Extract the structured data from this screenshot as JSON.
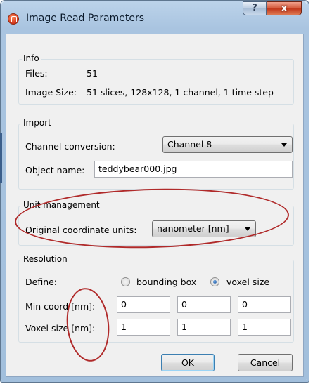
{
  "window": {
    "title": "Image Read Parameters",
    "help_label": "?",
    "close_label": "x"
  },
  "info": {
    "title": "Info",
    "files_label": "Files:",
    "files_value": "51",
    "image_size_label": "Image Size:",
    "image_size_value": "51 slices, 128x128, 1 channel, 1 time step"
  },
  "import": {
    "title": "Import",
    "channel_label": "Channel conversion:",
    "channel_value": "Channel 8",
    "object_name_label": "Object name:",
    "object_name_value": "teddybear000.jpg"
  },
  "units": {
    "title": "Unit management",
    "coord_units_label": "Original coordinate units:",
    "coord_units_value": "nanometer [nm]"
  },
  "resolution": {
    "title": "Resolution",
    "define_label": "Define:",
    "option_bbox": "bounding box",
    "option_voxel": "voxel size",
    "selected": "voxel size",
    "min_coord_label": "Min coord [nm]:",
    "min_coord": [
      "0",
      "0",
      "0"
    ],
    "voxel_size_label": "Voxel size [nm]:",
    "voxel_size": [
      "1",
      "1",
      "1"
    ]
  },
  "buttons": {
    "ok": "OK",
    "cancel": "Cancel"
  },
  "colors": {
    "title_bar": "#a9c4e0",
    "close_button": "#c2381b",
    "annotation": "#b02a2a",
    "dialog_bg": "#f0f0f0"
  }
}
